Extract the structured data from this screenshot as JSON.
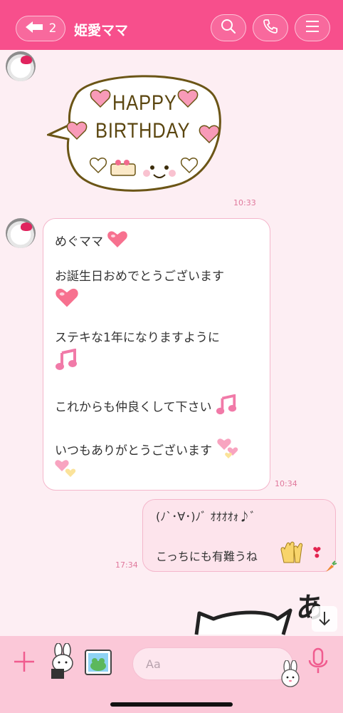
{
  "header": {
    "back_count": "2",
    "title": "姫愛ママ"
  },
  "messages": [
    {
      "type": "sticker",
      "sender": "incoming",
      "sticker_text_line1": "HAPPY",
      "sticker_text_line2": "BIRTHDAY",
      "time": "10:33"
    },
    {
      "type": "text",
      "sender": "incoming",
      "lines": [
        "めぐママ",
        "お誕生日おめでとうございます",
        "ステキな1年になりますように",
        "これからも仲良くして下さい",
        "いつもありがとうございます"
      ],
      "time": "10:34"
    },
    {
      "type": "text",
      "sender": "outgoing",
      "lines": [
        "(ﾉ`･∀･)ﾉﾞ ｵｵｵｵｫ♪ﾞ",
        "こっちにも有難うね"
      ],
      "time": "17:34"
    }
  ],
  "partial_sticker_text": "あ",
  "input": {
    "placeholder": "Aa"
  },
  "colors": {
    "header": "#f74f8c",
    "background": "#fdeef3",
    "bubble_border": "#f4b6cb",
    "bottom_bar": "#fbc8d8"
  }
}
